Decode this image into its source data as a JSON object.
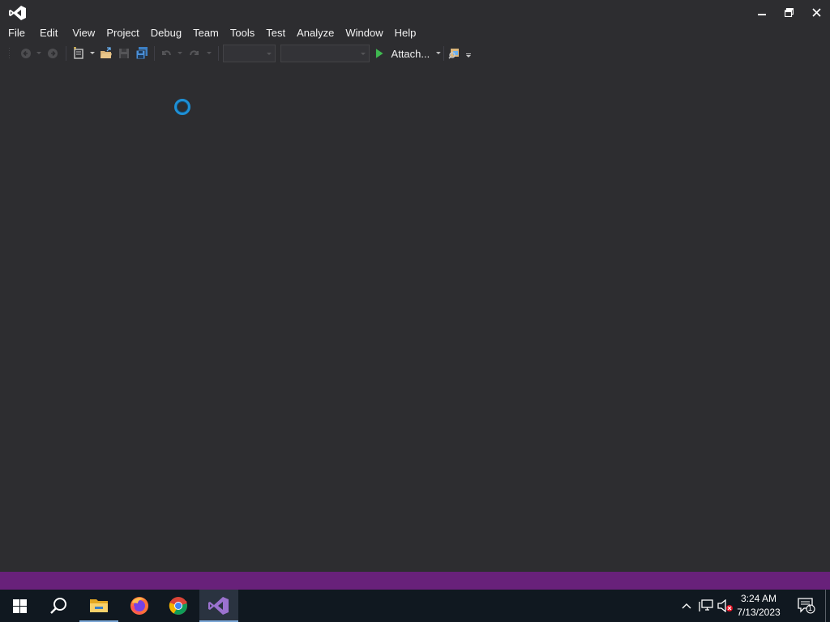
{
  "window": {
    "menu": [
      "File",
      "Edit",
      "View",
      "Project",
      "Debug",
      "Team",
      "Tools",
      "Test",
      "Analyze",
      "Window",
      "Help"
    ],
    "toolbar": {
      "attach_label": "Attach..."
    },
    "status": "loading",
    "accent_color": "#68217a",
    "spinner_color": "#1e90d6"
  },
  "taskbar": {
    "apps": [
      "start-icon",
      "search-icon",
      "file-explorer-icon",
      "firefox-icon",
      "chrome-icon",
      "visual-studio-icon"
    ],
    "active_app": "visual-studio-icon",
    "time": "3:24 AM",
    "date": "7/13/2023",
    "notification_count": "1"
  }
}
